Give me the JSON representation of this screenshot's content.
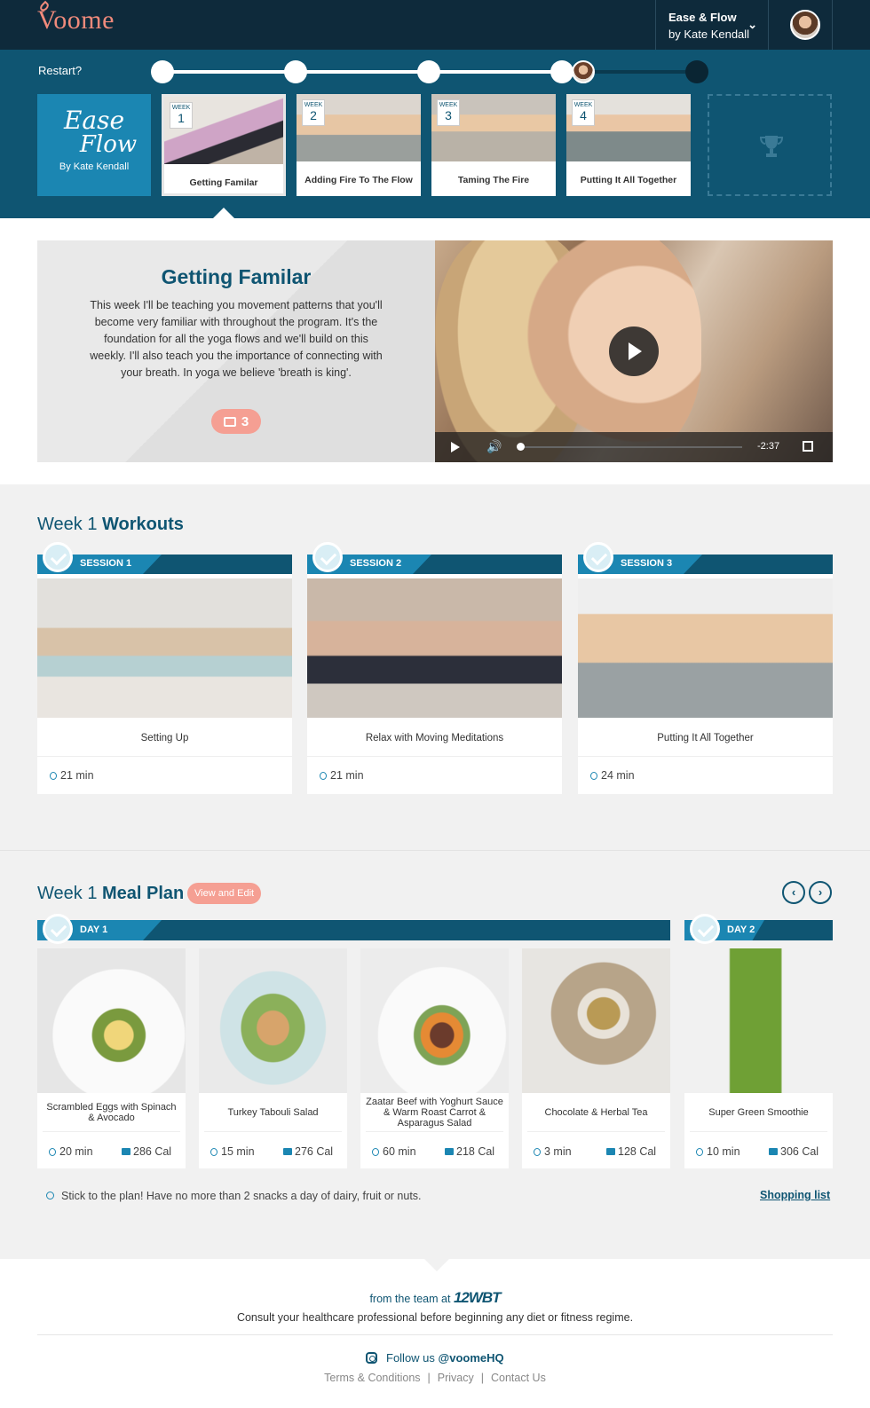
{
  "header": {
    "logo": "Voome",
    "program_title": "Ease & Flow",
    "program_author": "by Kate Kendall"
  },
  "progress": {
    "restart_label": "Restart?",
    "program_card": {
      "line1": "Ease",
      "line2": "Flow",
      "by": "By Kate Kendall"
    },
    "weeks": [
      {
        "week_label": "WEEK",
        "number": "1",
        "title": "Getting Familar"
      },
      {
        "week_label": "WEEK",
        "number": "2",
        "title": "Adding Fire To The Flow"
      },
      {
        "week_label": "WEEK",
        "number": "3",
        "title": "Taming The Fire"
      },
      {
        "week_label": "WEEK",
        "number": "4",
        "title": "Putting It All Together"
      }
    ],
    "current_week_index": 0
  },
  "intro": {
    "title": "Getting Familar",
    "body": "This week I'll be teaching you movement patterns that you'll become very familiar with throughout the program. It's the foundation for all the yoga flows and we'll build on this weekly. I'll also teach you the importance of connecting with your breath. In yoga we believe 'breath is king'.",
    "comment_count": "3",
    "video_time": "-2:37"
  },
  "workouts": {
    "title_prefix": "Week 1",
    "title_bold": "Workouts",
    "sessions": [
      {
        "label": "SESSION 1",
        "name": "Setting Up",
        "duration": "21 min"
      },
      {
        "label": "SESSION 2",
        "name": "Relax with Moving Meditations",
        "duration": "21 min"
      },
      {
        "label": "SESSION 3",
        "name": "Putting It All Together",
        "duration": "24 min"
      }
    ]
  },
  "meal_plan": {
    "title_prefix": "Week 1",
    "title_bold": "Meal Plan",
    "view_edit_label": "View and Edit",
    "prev_label": "‹",
    "next_label": "›",
    "day1_label": "DAY 1",
    "day2_label": "DAY 2",
    "meals": [
      {
        "name": "Scrambled Eggs with Spinach & Avocado",
        "time": "20 min",
        "cal": "286 Cal"
      },
      {
        "name": "Turkey Tabouli Salad",
        "time": "15 min",
        "cal": "276 Cal"
      },
      {
        "name": "Zaatar Beef with Yoghurt Sauce & Warm Roast Carrot & Asparagus Salad",
        "time": "60 min",
        "cal": "218 Cal"
      },
      {
        "name": "Chocolate & Herbal Tea",
        "time": "3 min",
        "cal": "128 Cal"
      },
      {
        "name": "Super Green Smoothie",
        "time": "10 min",
        "cal": "306 Cal"
      }
    ],
    "tip": "Stick to the plan! Have no more than 2 snacks a day of dairy, fruit or nuts.",
    "shopping_list": "Shopping list"
  },
  "footer": {
    "from_team": "from the team at",
    "brand": "12WBT",
    "consult": "Consult your healthcare professional before beginning any diet or fitness regime.",
    "follow_prefix": "Follow us",
    "handle": "@voomeHQ",
    "links": [
      "Terms & Conditions",
      "Privacy",
      "Contact Us"
    ]
  },
  "colors": {
    "navy": "#0e2a3b",
    "teal": "#0f5572",
    "accent_blue": "#1b86b2",
    "coral": "#f59f93"
  }
}
